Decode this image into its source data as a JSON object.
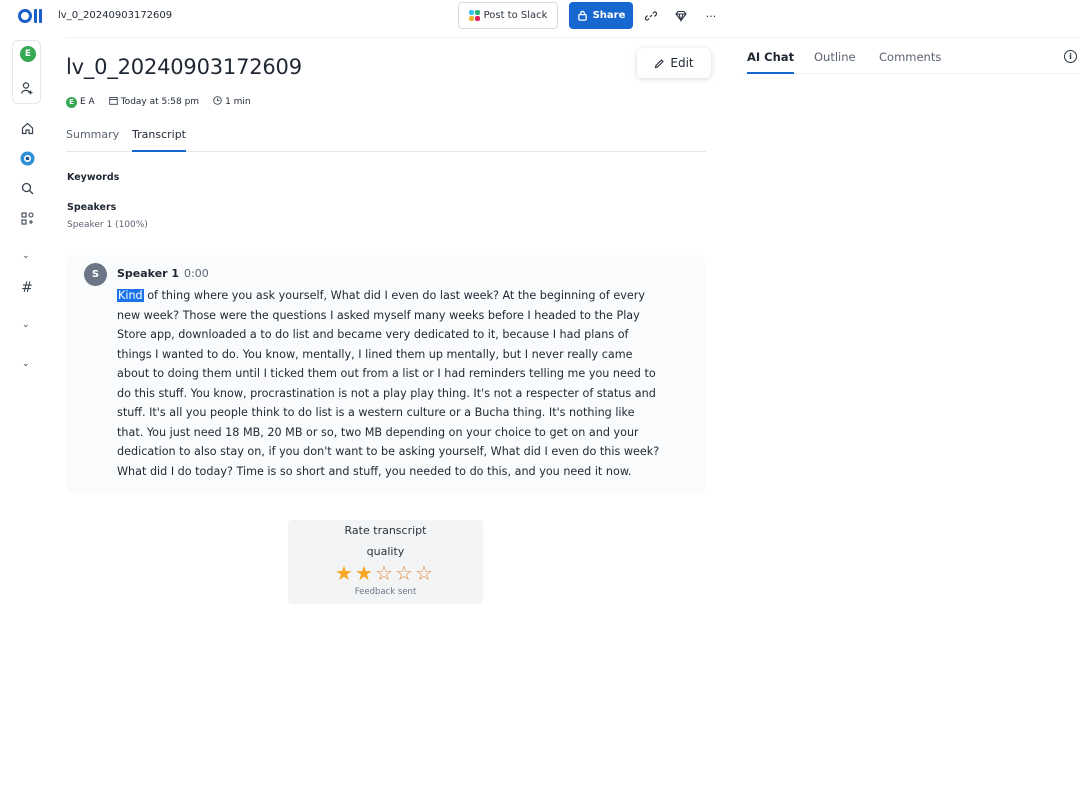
{
  "topbar": {
    "doc_name": "lv_0_20240903172609",
    "post_to_slack_label": "Post to Slack",
    "share_label": "Share"
  },
  "sidebar": {
    "avatar_letter": "E"
  },
  "main": {
    "title": "lv_0_20240903172609",
    "edit_label": "Edit",
    "meta": {
      "avatar_letter": "E",
      "owner": "E A",
      "date": "Today at 5:58 pm",
      "duration": "1 min"
    },
    "tabs": [
      {
        "label": "Summary",
        "active": false
      },
      {
        "label": "Transcript",
        "active": true
      }
    ],
    "keywords_label": "Keywords",
    "speakers_label": "Speakers",
    "speakers_value": "Speaker 1 (100%)",
    "transcript": {
      "speaker_initial": "S",
      "speaker_name": "Speaker 1",
      "timestamp": "0:00",
      "highlighted_word": "Kind",
      "lines": [
        " of thing where you ask yourself, What did I even do last week? At the beginning of every",
        "new week? Those were the questions I asked myself many weeks before I headed to the Play",
        "Store app, downloaded a to do list and became very dedicated to it, because I had plans of",
        "things I wanted to do. You know, mentally, I lined them up mentally, but I never really came",
        "about to doing them until I ticked them out from a list or I had reminders telling me you need to",
        "do this stuff. You know, procrastination is not a play play thing. It's not a respecter of status and",
        " stuff. It's all you people think to do list is a western culture or a Bucha thing. It's nothing like",
        "that. You just need 18 MB, 20 MB or so, two MB depending on your choice to get on and your",
        "dedication to also stay on, if you don't want to be asking yourself, What did I even do this week?",
        " What did I do today? Time is so short and stuff, you needed to do this, and you need it now."
      ]
    },
    "rating": {
      "title_line1": "Rate transcript",
      "title_line2": "quality",
      "value": 2,
      "max": 5,
      "feedback": "Feedback sent"
    }
  },
  "right_panel": {
    "tabs": [
      {
        "label": "AI Chat",
        "active": true
      },
      {
        "label": "Outline",
        "active": false
      },
      {
        "label": "Comments",
        "active": false
      }
    ]
  },
  "colors": {
    "accent": "#1767d1",
    "avatar_green": "#35a853",
    "highlight": "#1a73e8",
    "star": "#f5a623"
  },
  "icons": [
    "otter-logo",
    "slack-icon",
    "lock-icon",
    "link-icon",
    "gem-icon",
    "more-icon",
    "add-user-icon",
    "home-icon",
    "otter-circle-icon",
    "search-icon",
    "apps-icon",
    "hashtag-icon",
    "chevron-down-icon",
    "pencil-icon",
    "calendar-icon",
    "clock-icon",
    "info-icon",
    "star-icon"
  ]
}
